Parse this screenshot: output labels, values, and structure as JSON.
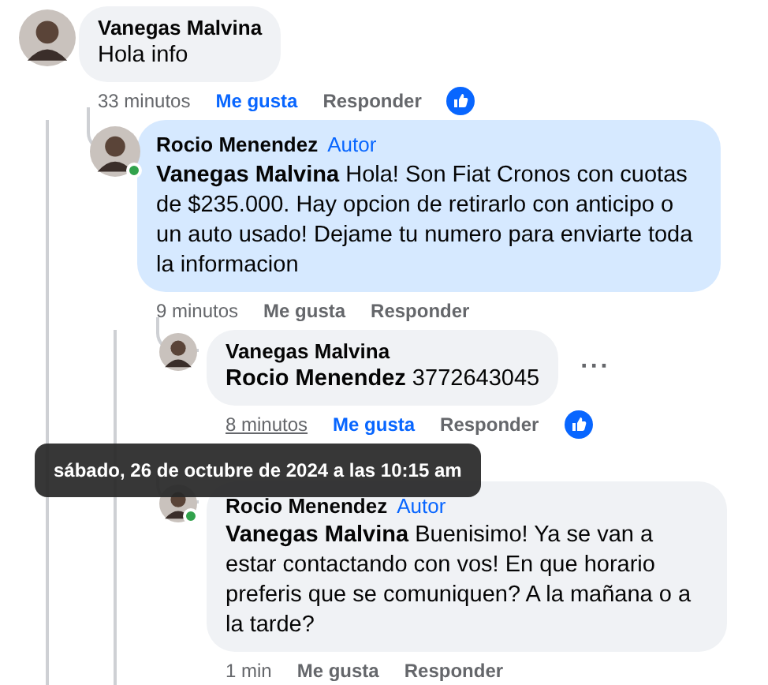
{
  "comments": [
    {
      "author": "Vanegas Malvina",
      "text": "Hola info",
      "time": "33 minutos",
      "like_label": "Me gusta",
      "reply_label": "Responder",
      "liked": true,
      "reaction_shown": true,
      "online": false,
      "highlighted": false,
      "time_hovered": false,
      "children": [
        {
          "author": "Rocio Menendez",
          "badge": "Autor",
          "mention": "Vanegas Malvina",
          "text": "Hola! Son Fiat Cronos con cuotas de $235.000. Hay opcion de retirarlo con anticipo o un auto usado! Dejame tu numero para enviarte toda la informacion",
          "time": "9 minutos",
          "like_label": "Me gusta",
          "reply_label": "Responder",
          "liked": false,
          "reaction_shown": false,
          "online": true,
          "highlighted": true,
          "time_hovered": false,
          "children": [
            {
              "author": "Vanegas Malvina",
              "mention": "Rocio Menendez",
              "text": "3772643045",
              "more": "···",
              "time": "8 minutos",
              "like_label": "Me gusta",
              "reply_label": "Responder",
              "liked": true,
              "reaction_shown": true,
              "online": false,
              "highlighted": false,
              "time_hovered": true
            },
            {
              "author": "Rocio Menendez",
              "badge": "Autor",
              "mention": "Vanegas Malvina",
              "text": "Buenisimo! Ya se van a estar contactando con vos! En que horario preferis que se comuniquen? A la mañana o a la tarde?",
              "time": "1 min",
              "like_label": "Me gusta",
              "reply_label": "Responder",
              "liked": false,
              "reaction_shown": false,
              "online": true,
              "highlighted": false,
              "time_hovered": false
            }
          ]
        }
      ]
    }
  ],
  "tooltip": {
    "text": "sábado, 26 de octubre de 2024 a las 10:15 am"
  }
}
